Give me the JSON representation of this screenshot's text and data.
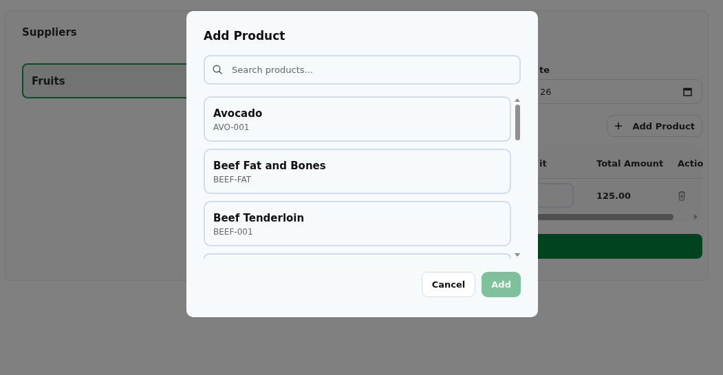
{
  "background": {
    "suppliers_title": "Suppliers",
    "suppliers": [
      {
        "name": "Fruits",
        "selected": true
      }
    ],
    "date_label": "te",
    "date_value": "26",
    "add_product_button": "Add Product",
    "table": {
      "columns": [
        "it",
        "Total Amount",
        "Actio"
      ],
      "rows": [
        {
          "total": "125.00"
        }
      ]
    }
  },
  "modal": {
    "title": "Add Product",
    "search": {
      "placeholder": "Search products..."
    },
    "products": [
      {
        "name": "Avocado",
        "code": "AVO-001"
      },
      {
        "name": "Beef Fat and Bones",
        "code": "BEEF-FAT"
      },
      {
        "name": "Beef Tenderloin",
        "code": "BEEF-001"
      }
    ],
    "buttons": [
      {
        "label": "Cancel",
        "kind": "secondary",
        "disabled": false
      },
      {
        "label": "Add",
        "kind": "primary",
        "disabled": true
      }
    ]
  }
}
